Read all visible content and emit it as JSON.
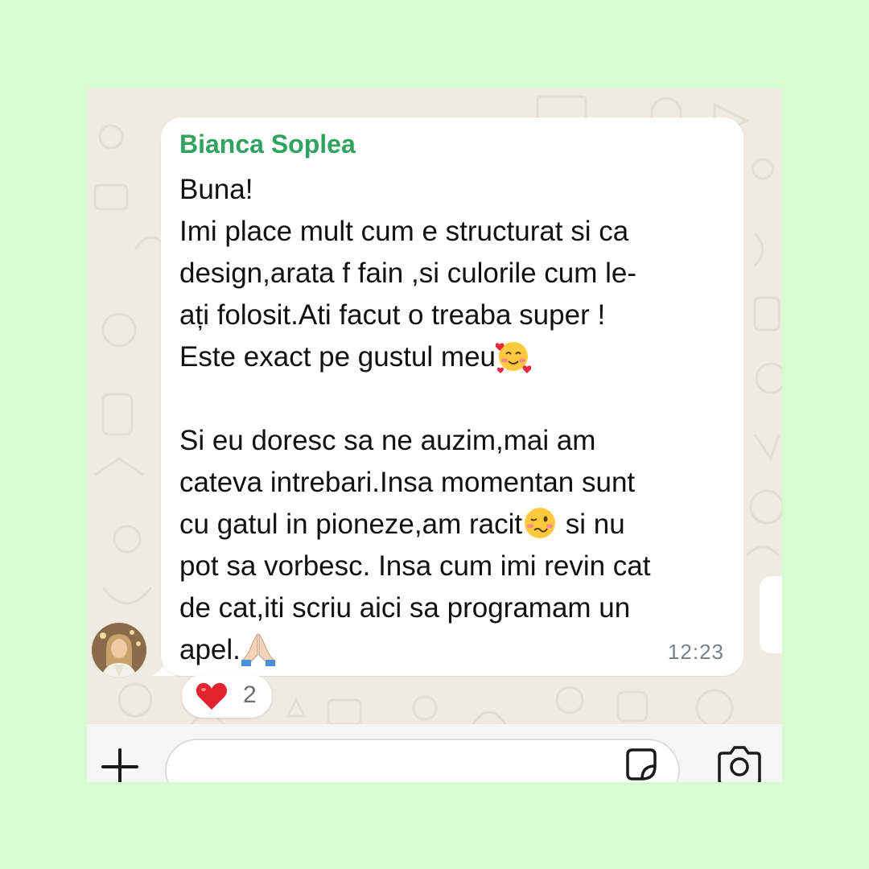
{
  "chat": {
    "sender_name": "Bianca Soplea",
    "sender_color": "#2fa35f",
    "message_lines": [
      "Buna!",
      "Imi place mult cum e structurat si ca",
      "design,arata f fain ,si culorile cum le-",
      "ați folosit.Ati facut o treaba super !",
      "Este exact pe gustul meu",
      "",
      "Si eu doresc sa ne auzim,mai am",
      "cateva intrebari.Insa momentan sunt",
      "cu gatul in pioneze,am racit",
      " si nu",
      "pot sa vorbesc. Insa cum imi revin cat",
      "de cat,iti scriu aici sa programam un",
      "apel."
    ],
    "emojis": [
      "smiling-face-with-hearts-icon",
      "woozy-face-icon",
      "folded-hands-icon"
    ],
    "timestamp": "12:23",
    "reaction": {
      "icon": "red-heart-icon",
      "count": "2"
    }
  },
  "input_bar": {
    "placeholder": "",
    "buttons": [
      "plus-icon",
      "sticker-icon",
      "camera-icon"
    ]
  },
  "colors": {
    "page_background": "#d6fdd0",
    "chat_background": "#efeae2",
    "bubble": "#ffffff"
  }
}
